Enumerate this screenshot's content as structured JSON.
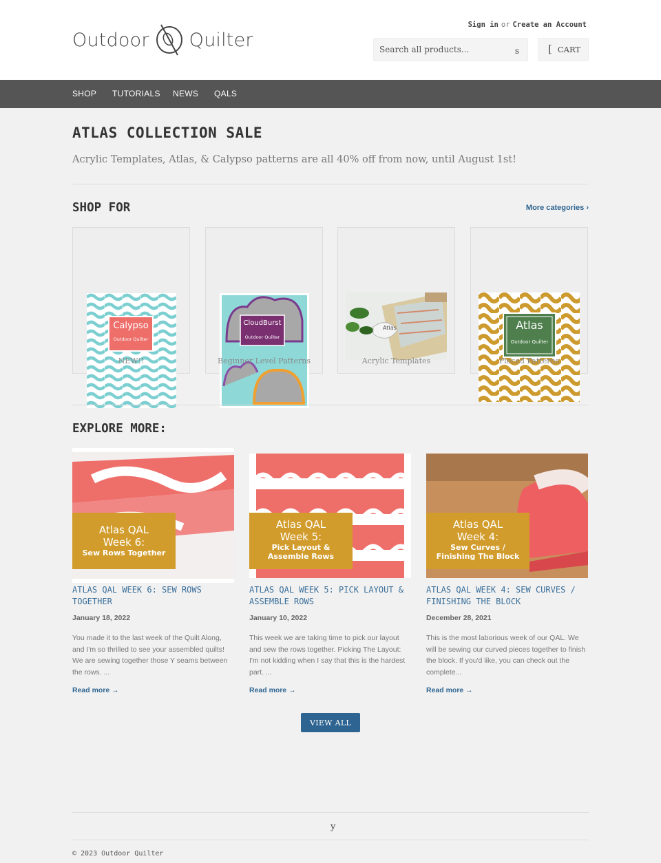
{
  "header": {
    "logo_left": "Outdoor",
    "logo_right": "Quilter",
    "sign_in": "Sign in",
    "or": "or",
    "create_account": "Create an Account",
    "search_placeholder": "Search all products...",
    "search_button": "s",
    "cart_icon": "[",
    "cart_label": "CART"
  },
  "nav": {
    "items": [
      {
        "label": "SHOP"
      },
      {
        "label": "TUTORIALS"
      },
      {
        "label": "NEWS"
      },
      {
        "label": "QALS"
      }
    ]
  },
  "hero": {
    "title": "ATLAS COLLECTION SALE",
    "subtitle": "Acrylic Templates, Atlas, & Calypso patterns are all 40% off from now, until August 1st!"
  },
  "shop_for": {
    "title": "SHOP FOR",
    "more_link": "More categories ›",
    "categories": [
      {
        "label": "NEW!!",
        "image_text": "Calypso",
        "image_sub": "Outdoor Quilter"
      },
      {
        "label": "Beginner Level Patterns",
        "image_text": "CloudBurst",
        "image_sub": "Outdoor Quilter"
      },
      {
        "label": "Acrylic Templates",
        "image_text": "Atlas"
      },
      {
        "label": "Pieced Patterns",
        "image_text": "Atlas",
        "image_sub": "Outdoor Quilter"
      }
    ]
  },
  "explore": {
    "title": "EXPLORE MORE:",
    "posts": [
      {
        "title": "ATLAS QAL WEEK 6: SEW ROWS TOGETHER",
        "date": "January 18, 2022",
        "excerpt": "You made it to the last week of the Quilt Along, and I'm so thrilled to see your assembled quilts!   We are sewing together those Y seams between the rows. ...",
        "more": "Read more →",
        "banner_l1": "Atlas QAL",
        "banner_l2": "Week 6:",
        "banner_l3": "Sew Rows Together",
        "banner_l4": ""
      },
      {
        "title": "ATLAS QAL WEEK 5: PICK LAYOUT & ASSEMBLE ROWS",
        "date": "January 10, 2022",
        "excerpt": "This week we are taking time to pick our layout and sew the rows together.  Picking The Layout: I'm not kidding when I say that this is the hardest part. ...",
        "more": "Read more →",
        "banner_l1": "Atlas QAL",
        "banner_l2": "Week 5:",
        "banner_l3": "Pick Layout &",
        "banner_l4": "Assemble Rows"
      },
      {
        "title": "ATLAS QAL WEEK 4: SEW CURVES / FINISHING THE BLOCK",
        "date": "December 28, 2021",
        "excerpt": "This is the most laborious week of our QAL.  We will be sewing our curved pieces together to finish the block.  If you'd like, you can check out the complete...",
        "more": "Read more →",
        "banner_l1": "Atlas QAL",
        "banner_l2": "Week 4:",
        "banner_l3": "Sew Curves /",
        "banner_l4": "Finishing The Block"
      }
    ],
    "view_all": "VIEW ALL"
  },
  "footer": {
    "icon": "y",
    "copyright": "© 2023 Outdoor Quilter"
  },
  "colors": {
    "nav_bg": "#555555",
    "link": "#2d6491",
    "accent_banner": "#d29c2c",
    "salmon": "#ee6e6a"
  }
}
